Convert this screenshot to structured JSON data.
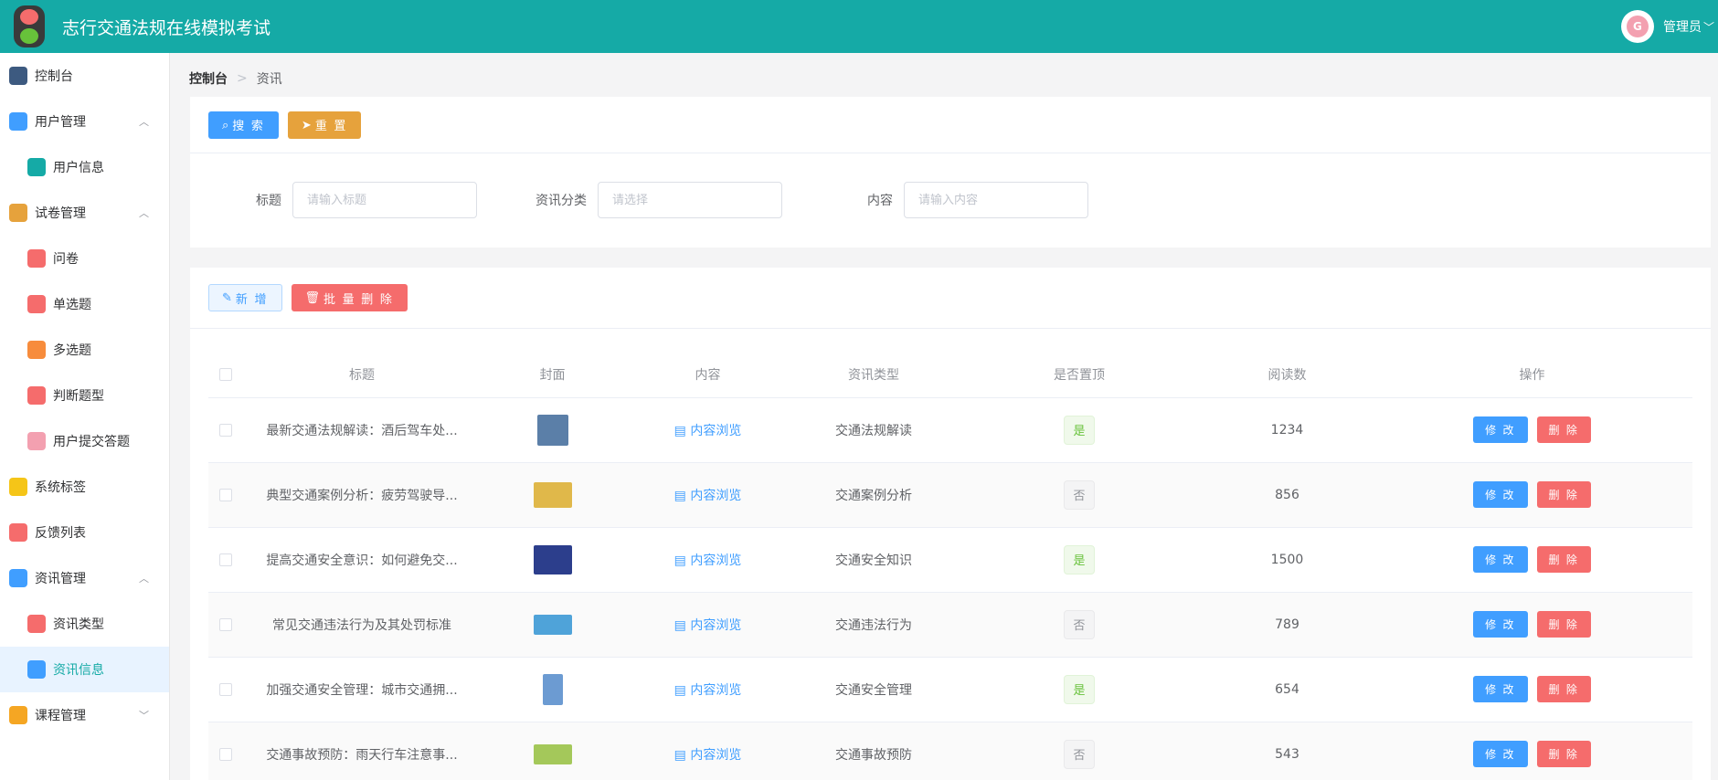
{
  "header": {
    "title": "志行交通法规在线模拟考试",
    "user": "管理员",
    "avatar_text": "G"
  },
  "sidebar": {
    "items": [
      {
        "label": "控制台",
        "level": "top",
        "icon": "dashboard-icon",
        "color": "#3d5a80",
        "active": false,
        "arrow": ""
      },
      {
        "label": "用户管理",
        "level": "top",
        "icon": "user-group-icon",
        "color": "#409eff",
        "active": false,
        "arrow": "︿"
      },
      {
        "label": "用户信息",
        "level": "sub",
        "icon": "user-info-icon",
        "color": "#15aaa6",
        "active": false,
        "arrow": ""
      },
      {
        "label": "试卷管理",
        "level": "top",
        "icon": "paper-icon",
        "color": "#e6a23c",
        "active": false,
        "arrow": "︿"
      },
      {
        "label": "问卷",
        "level": "sub",
        "icon": "questionnaire-icon",
        "color": "#f56c6c",
        "active": false,
        "arrow": ""
      },
      {
        "label": "单选题",
        "level": "sub",
        "icon": "single-choice-icon",
        "color": "#f56c6c",
        "active": false,
        "arrow": ""
      },
      {
        "label": "多选题",
        "level": "sub",
        "icon": "multi-choice-icon",
        "color": "#f78c3c",
        "active": false,
        "arrow": ""
      },
      {
        "label": "判断题型",
        "level": "sub",
        "icon": "judge-icon",
        "color": "#f56c6c",
        "active": false,
        "arrow": ""
      },
      {
        "label": "用户提交答题",
        "level": "sub",
        "icon": "submission-icon",
        "color": "#f3a0b0",
        "active": false,
        "arrow": ""
      },
      {
        "label": "系统标签",
        "level": "top",
        "icon": "tag-icon",
        "color": "#f5c518",
        "active": false,
        "arrow": ""
      },
      {
        "label": "反馈列表",
        "level": "top",
        "icon": "feedback-icon",
        "color": "#f56c6c",
        "active": false,
        "arrow": ""
      },
      {
        "label": "资讯管理",
        "level": "top",
        "icon": "news-manage-icon",
        "color": "#409eff",
        "active": false,
        "arrow": "︿"
      },
      {
        "label": "资讯类型",
        "level": "sub",
        "icon": "news-type-icon",
        "color": "#f56c6c",
        "active": false,
        "arrow": ""
      },
      {
        "label": "资讯信息",
        "level": "sub",
        "icon": "news-info-icon",
        "color": "#409eff",
        "active": true,
        "arrow": ""
      },
      {
        "label": "课程管理",
        "level": "top",
        "icon": "course-icon",
        "color": "#f5a623",
        "active": false,
        "arrow": "﹀"
      }
    ]
  },
  "breadcrumb": {
    "first": "控制台",
    "sep": ">",
    "second": "资讯"
  },
  "search": {
    "search_label": "搜 索",
    "reset_label": "重 置",
    "fields": {
      "title_label": "标题",
      "title_placeholder": "请输入标题",
      "category_label": "资讯分类",
      "category_placeholder": "请选择",
      "content_label": "内容",
      "content_placeholder": "请输入内容"
    }
  },
  "actions": {
    "add_label": "新 增",
    "batch_delete_label": "批 量 删 除"
  },
  "table": {
    "headers": [
      "标题",
      "封面",
      "内容",
      "资讯类型",
      "是否置顶",
      "阅读数",
      "操作"
    ],
    "view_label": "内容浏览",
    "edit_label": "修 改",
    "delete_label": "删 除",
    "rows": [
      {
        "title": "最新交通法规解读：酒后驾车处...",
        "type": "交通法规解读",
        "pinned": "是",
        "pinned_bool": true,
        "reads": "1234",
        "cover_color": "#5b7fa8"
      },
      {
        "title": "典型交通案例分析：疲劳驾驶导...",
        "type": "交通案例分析",
        "pinned": "否",
        "pinned_bool": false,
        "reads": "856",
        "cover_color": "#e0b84a"
      },
      {
        "title": "提高交通安全意识：如何避免交...",
        "type": "交通安全知识",
        "pinned": "是",
        "pinned_bool": true,
        "reads": "1500",
        "cover_color": "#2c3e8c"
      },
      {
        "title": "常见交通违法行为及其处罚标准",
        "type": "交通违法行为",
        "pinned": "否",
        "pinned_bool": false,
        "reads": "789",
        "cover_color": "#4fa3d9"
      },
      {
        "title": "加强交通安全管理：城市交通拥...",
        "type": "交通安全管理",
        "pinned": "是",
        "pinned_bool": true,
        "reads": "654",
        "cover_color": "#6c9bd2"
      },
      {
        "title": "交通事故预防：雨天行车注意事...",
        "type": "交通事故预防",
        "pinned": "否",
        "pinned_bool": false,
        "reads": "543",
        "cover_color": "#a4c85a"
      }
    ]
  }
}
